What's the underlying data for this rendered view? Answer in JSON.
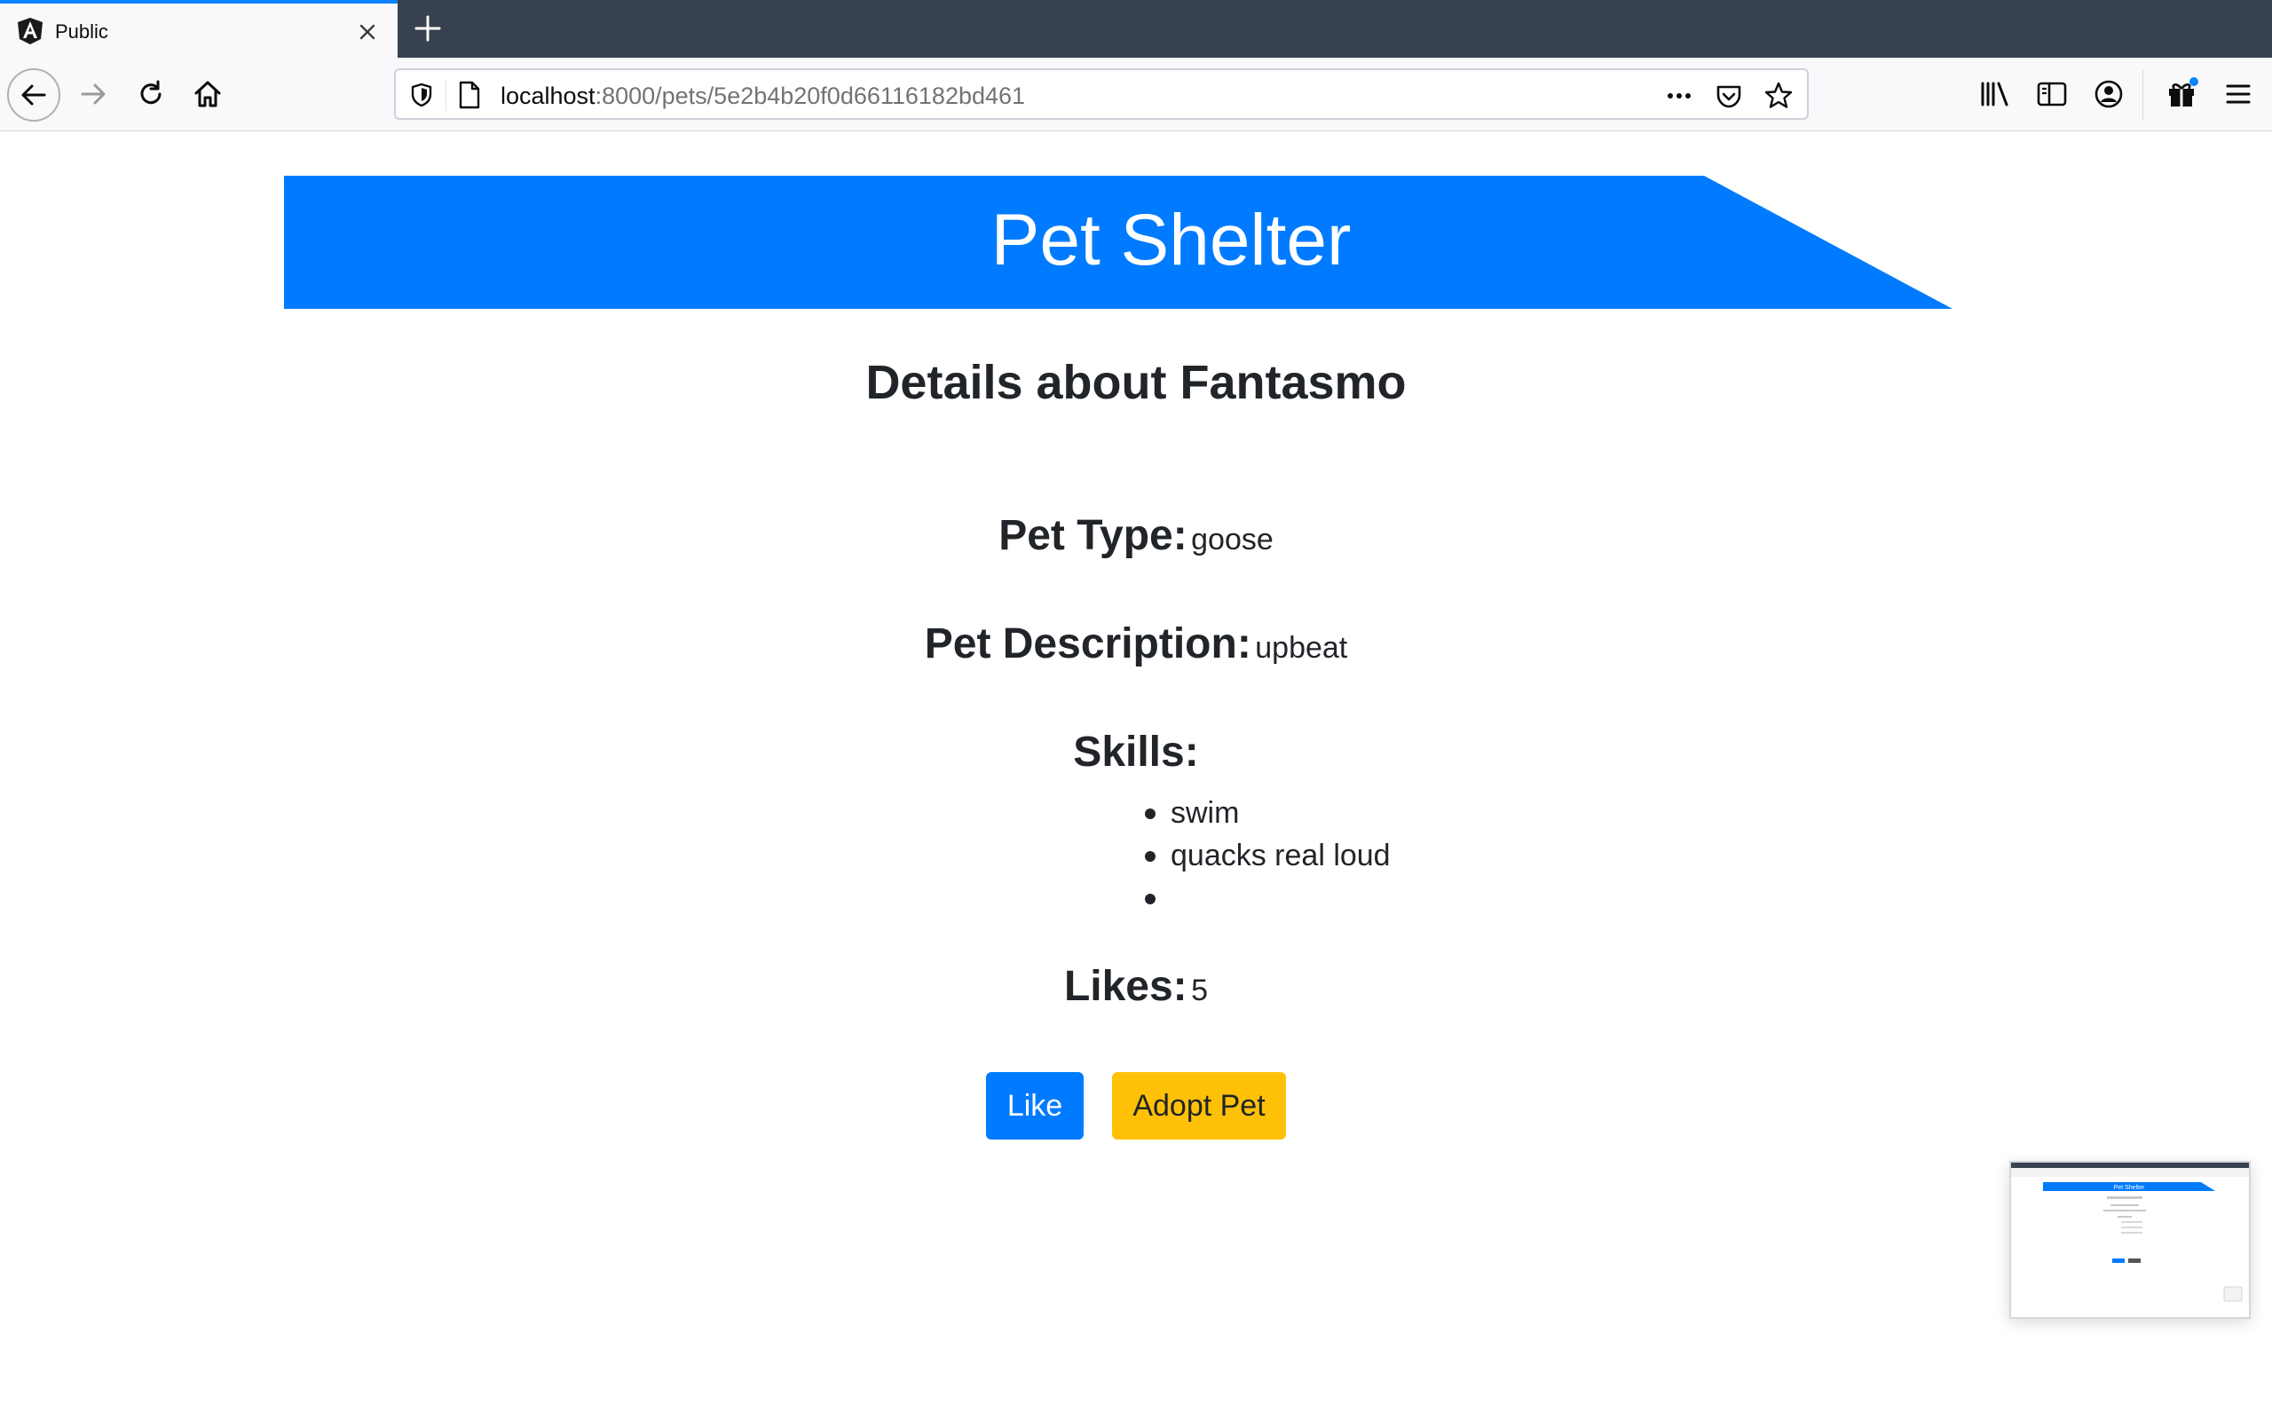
{
  "browser": {
    "tab": {
      "title": "Public"
    },
    "url": {
      "host": "localhost",
      "rest": ":8000/pets/5e2b4b20f0d66116182bd461"
    }
  },
  "header": {
    "title": "Pet Shelter"
  },
  "pet": {
    "page_title": "Details about Fantasmo",
    "type_label": "Pet Type:",
    "type_value": "goose",
    "description_label": "Pet Description:",
    "description_value": "upbeat",
    "skills_label": "Skills:",
    "skills": [
      "swim",
      "quacks real loud",
      ""
    ],
    "likes_label": "Likes:",
    "likes_value": "5"
  },
  "actions": {
    "like_label": "Like",
    "adopt_label": "Adopt Pet"
  },
  "thumbnail": {
    "header_title": "Pet Shelter"
  },
  "colors": {
    "banner": "#007bff",
    "like_button": "#007bff",
    "adopt_button": "#ffc107",
    "tabstrip": "#38414f"
  }
}
